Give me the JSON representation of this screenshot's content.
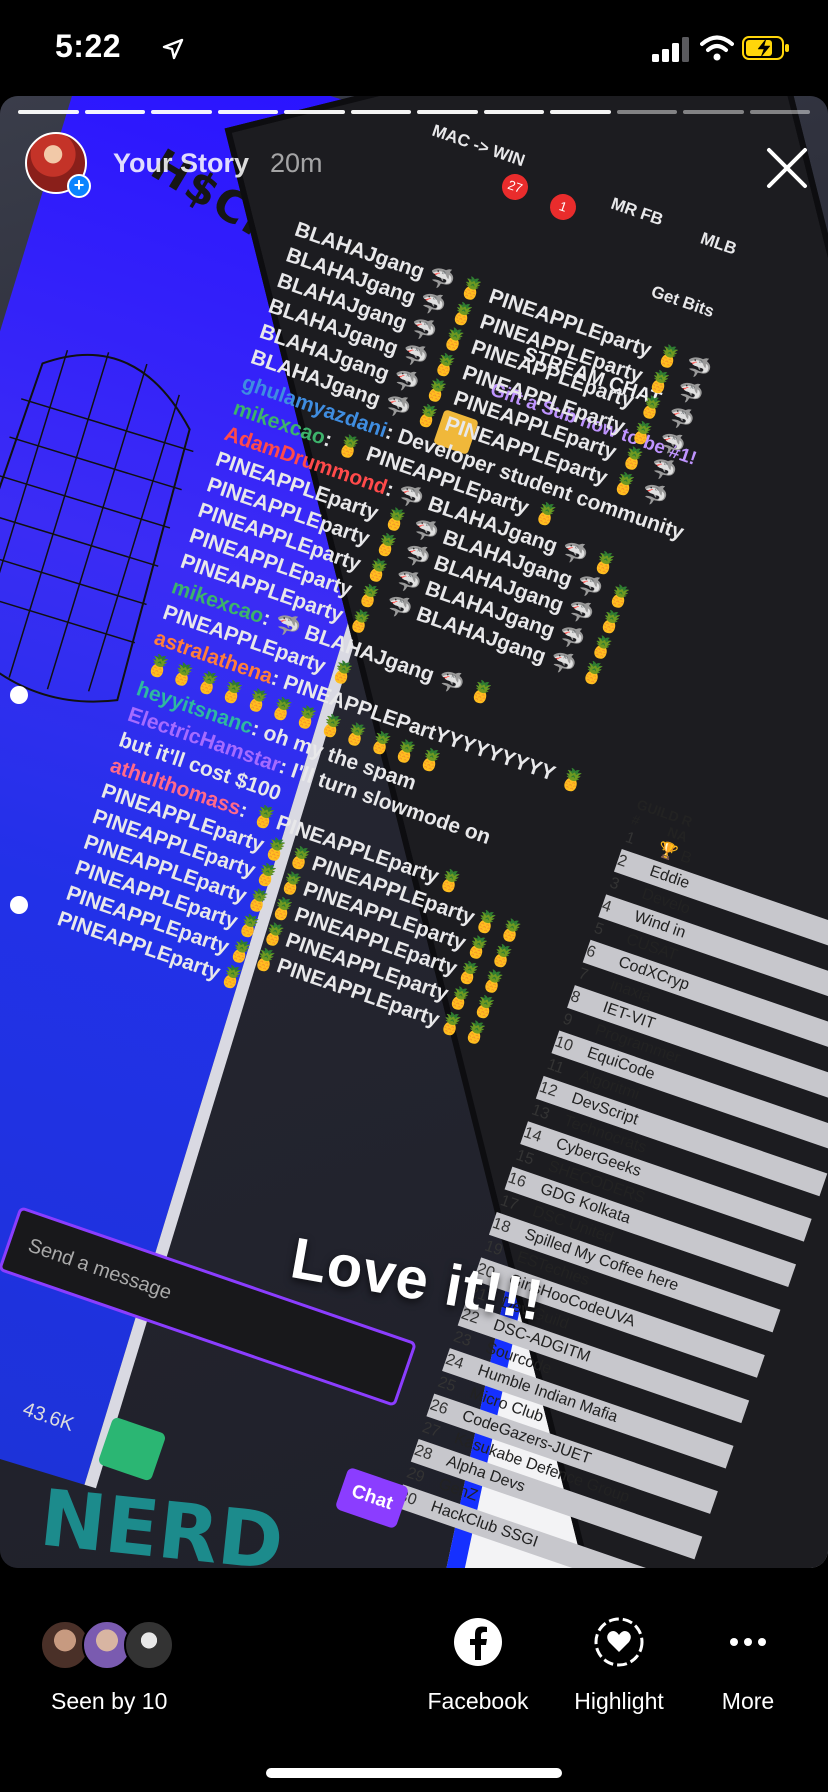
{
  "status_bar": {
    "time": "5:22"
  },
  "story_header": {
    "username": "Your Story",
    "age": "20m"
  },
  "screen_content": {
    "poster_title": "H$CK DAY",
    "browser_bookmarks": [
      "MAC -> WIN",
      "MR FB",
      "MLB",
      "Get Bits"
    ],
    "notification_counts": [
      "27",
      "1"
    ],
    "chat_title": "STREAM CHAT",
    "gift_banner": "Gift a Sub now to be #1!",
    "chat_lines": [
      {
        "user": "",
        "text": "BLAHAJgang 🦈 🍍 PINEAPPLEparty 🍍 🦈",
        "color": ""
      },
      {
        "user": "",
        "text": "BLAHAJgang 🦈 🍍 PINEAPPLEparty 🍍 🦈",
        "color": ""
      },
      {
        "user": "",
        "text": "BLAHAJgang 🦈 🍍 PINEAPPLEparty 🍍 🦈",
        "color": ""
      },
      {
        "user": "",
        "text": "BLAHAJgang 🦈 🍍 PINEAPPLEparty 🍍 🦈",
        "color": ""
      },
      {
        "user": "",
        "text": "BLAHAJgang 🦈 🍍 PINEAPPLEparty 🍍 🦈",
        "color": ""
      },
      {
        "user": "",
        "text": "BLAHAJgang 🦈 🍍 PINEAPPLEparty 🍍 🦈",
        "color": ""
      },
      {
        "user": "ghulamyazdani",
        "text": ": Developer student community",
        "color": "u-blue"
      },
      {
        "user": "mikexcao",
        "text": ": 🍍 PINEAPPLEparty 🍍",
        "color": "u-green"
      },
      {
        "user": "AdamDrummond",
        "text": ": 🦈 BLAHAJgang 🦈 🍍",
        "color": "u-red"
      },
      {
        "user": "",
        "text": "PINEAPPLEparty 🍍 🦈 BLAHAJgang 🦈 🍍",
        "color": ""
      },
      {
        "user": "",
        "text": "PINEAPPLEparty 🍍 🦈 BLAHAJgang 🦈 🍍",
        "color": ""
      },
      {
        "user": "",
        "text": "PINEAPPLEparty 🍍 🦈 BLAHAJgang 🦈 🍍",
        "color": ""
      },
      {
        "user": "",
        "text": "PINEAPPLEparty 🍍 🦈 BLAHAJgang 🦈 🍍",
        "color": ""
      },
      {
        "user": "",
        "text": "PINEAPPLEparty 🍍",
        "color": ""
      },
      {
        "user": "mikexcao",
        "text": ": 🦈 BLAHAJgang 🦈 🍍",
        "color": "u-green"
      },
      {
        "user": "",
        "text": "PINEAPPLEparty 🍍",
        "color": ""
      },
      {
        "user": "astralathena",
        "text": ": PINEAPPLEPartYYYYYYYYY 🍍",
        "color": "u-orange"
      },
      {
        "user": "",
        "text": "🍍🍍🍍🍍🍍🍍🍍🍍🍍🍍🍍🍍",
        "color": ""
      },
      {
        "user": "heyyitsnanc",
        "text": ": oh my the spam",
        "color": "u-teal"
      },
      {
        "user": "ElectricHamstar",
        "text": ": I'll turn slowmode on",
        "color": "u-purple"
      },
      {
        "user": "",
        "text": "but it'll cost $100",
        "color": ""
      },
      {
        "user": "athulthomass",
        "text": ": 🍍PINEAPPLEparty🍍",
        "color": "u-pink"
      },
      {
        "user": "",
        "text": "PINEAPPLEparty🍍🍍PINEAPPLEparty🍍🍍",
        "color": ""
      },
      {
        "user": "",
        "text": "PINEAPPLEparty🍍🍍PINEAPPLEparty🍍🍍",
        "color": ""
      },
      {
        "user": "",
        "text": "PINEAPPLEparty🍍🍍PINEAPPLEparty🍍🍍",
        "color": ""
      },
      {
        "user": "",
        "text": "PINEAPPLEparty🍍🍍PINEAPPLEparty🍍🍍",
        "color": ""
      },
      {
        "user": "",
        "text": "PINEAPPLEparty🍍🍍PINEAPPLEparty🍍🍍",
        "color": ""
      },
      {
        "user": "",
        "text": "PINEAPPLEparty🍍",
        "color": ""
      }
    ],
    "message_placeholder": "Send a message",
    "viewer_count": "43.6K",
    "chat_button": "Chat",
    "bottom_logo": "NERD",
    "guild_header": "GUILD R",
    "guild_col_num": "#",
    "guild_col_name": "NA",
    "guild_rows": [
      {
        "num": "1",
        "name": "🏆 B"
      },
      {
        "num": "2",
        "name": "Eddie"
      },
      {
        "num": "3",
        "name": "Develo"
      },
      {
        "num": "4",
        "name": "Wind in"
      },
      {
        "num": "5",
        "name": "CUSAT"
      },
      {
        "num": "6",
        "name": "CodXCryp"
      },
      {
        "num": "7",
        "name": "inaxia"
      },
      {
        "num": "8",
        "name": "IET-VIT"
      },
      {
        "num": "9",
        "name": "Programmer"
      },
      {
        "num": "10",
        "name": "EquiCode"
      },
      {
        "num": "11",
        "name": "Algoritmi"
      },
      {
        "num": "12",
        "name": "DevScript"
      },
      {
        "num": "13",
        "name": "Technocrats"
      },
      {
        "num": "14",
        "name": "CyberGeeks"
      },
      {
        "num": "15",
        "name": "SHECODERS"
      },
      {
        "num": "16",
        "name": "GDG Kolkata"
      },
      {
        "num": "17",
        "name": "DSC United"
      },
      {
        "num": "18",
        "name": "Spilled My Coffee here"
      },
      {
        "num": "19",
        "name": "ESTechies"
      },
      {
        "num": "20",
        "name": "GirlsHooCodeUVA"
      },
      {
        "num": "21",
        "name": "Dev Guild"
      },
      {
        "num": "22",
        "name": "DSC-ADGITM"
      },
      {
        "num": "23",
        "name": "Sourcode"
      },
      {
        "num": "24",
        "name": "Humble Indian Mafia"
      },
      {
        "num": "25",
        "name": "Micro Club"
      },
      {
        "num": "26",
        "name": "CodeGazers-JUET"
      },
      {
        "num": "27",
        "name": "Kasukabe Defence Group"
      },
      {
        "num": "28",
        "name": "Alpha Devs"
      },
      {
        "num": "29",
        "name": "GenZ"
      },
      {
        "num": "30",
        "name": "HackClub SSGI"
      }
    ]
  },
  "sticker_text": "Love it!!!",
  "bottom_bar": {
    "seen_label": "Seen by 10",
    "actions": [
      {
        "label": "Facebook",
        "icon": "facebook-icon"
      },
      {
        "label": "Highlight",
        "icon": "highlight-heart-icon"
      },
      {
        "label": "More",
        "icon": "more-dots-icon"
      }
    ]
  },
  "colors": {
    "twitch_purple": "#8b3dff",
    "facebook_blue": "#ffffff",
    "battery_yellow": "#ffd60a"
  }
}
